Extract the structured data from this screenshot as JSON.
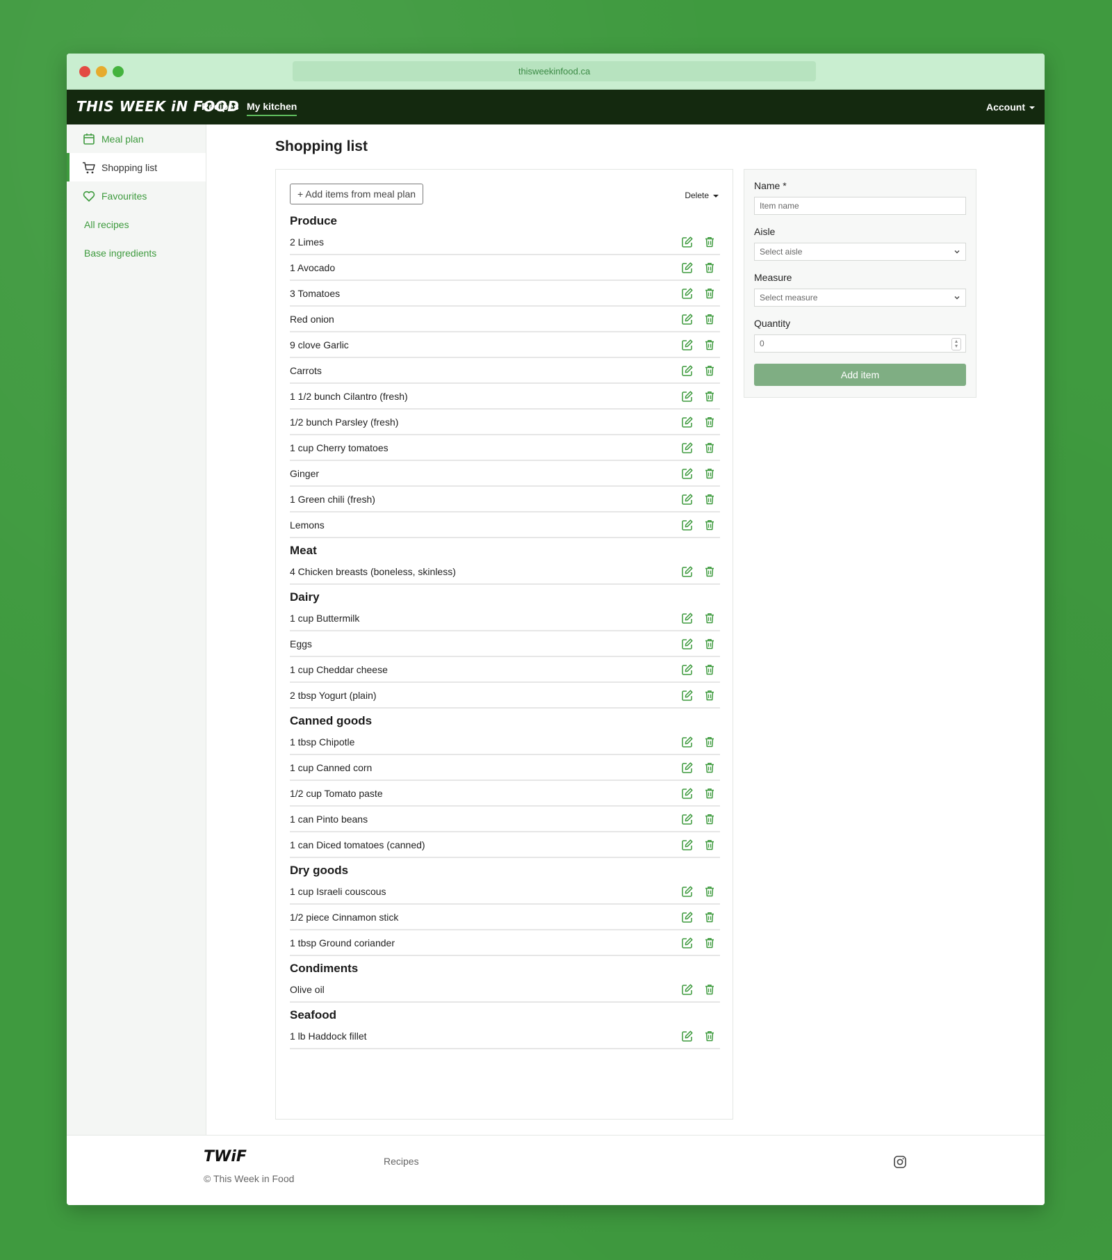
{
  "browser": {
    "url": "thisweekinfood.ca"
  },
  "nav": {
    "brand": "THIS WEEK iN FOOD",
    "links": [
      "Recipes",
      "My kitchen"
    ],
    "account": "Account"
  },
  "sidebar": {
    "items": [
      {
        "label": "Meal plan",
        "icon": "calendar-icon"
      },
      {
        "label": "Shopping list",
        "icon": "cart-icon"
      },
      {
        "label": "Favourites",
        "icon": "heart-icon"
      },
      {
        "label": "All recipes"
      },
      {
        "label": "Base ingredients"
      }
    ]
  },
  "main": {
    "title": "Shopping list",
    "add_button": "+ Add items from meal plan",
    "delete_menu": "Delete",
    "sections": [
      {
        "title": "Produce",
        "items": [
          "2 Limes",
          "1 Avocado",
          "3 Tomatoes",
          "Red onion",
          "9 clove Garlic",
          "Carrots",
          "1 1/2 bunch Cilantro (fresh)",
          "1/2 bunch Parsley (fresh)",
          "1 cup Cherry tomatoes",
          "Ginger",
          "1 Green chili (fresh)",
          "Lemons"
        ]
      },
      {
        "title": "Meat",
        "items": [
          "4 Chicken breasts (boneless, skinless)"
        ]
      },
      {
        "title": "Dairy",
        "items": [
          "1 cup Buttermilk",
          "Eggs",
          "1 cup Cheddar cheese",
          "2 tbsp Yogurt (plain)"
        ]
      },
      {
        "title": "Canned goods",
        "items": [
          "1 tbsp Chipotle",
          "1 cup Canned corn",
          "1/2 cup Tomato paste",
          "1 can Pinto beans",
          "1 can Diced tomatoes (canned)"
        ]
      },
      {
        "title": "Dry goods",
        "items": [
          "1 cup Israeli couscous",
          "1/2 piece Cinnamon stick",
          "1 tbsp Ground coriander"
        ]
      },
      {
        "title": "Condiments",
        "items": [
          "Olive oil"
        ]
      },
      {
        "title": "Seafood",
        "items": [
          "1 lb Haddock fillet"
        ]
      }
    ]
  },
  "form": {
    "name_label": "Name *",
    "name_placeholder": "Item name",
    "aisle_label": "Aisle",
    "aisle_value": "Select aisle",
    "measure_label": "Measure",
    "measure_value": "Select measure",
    "quantity_label": "Quantity",
    "quantity_value": "0",
    "submit": "Add item"
  },
  "footer": {
    "logo": "TWiF",
    "copyright": "© This Week in Food",
    "link": "Recipes",
    "social_icon": "instagram-icon"
  },
  "colors": {
    "accent": "#3d9a3d",
    "nav_bg": "#14290f",
    "chrome_bg": "#c9eed0",
    "button": "#7fae83"
  }
}
